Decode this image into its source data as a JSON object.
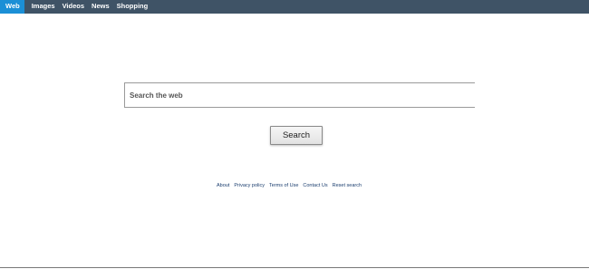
{
  "nav": {
    "items": [
      {
        "label": "Web",
        "active": true
      },
      {
        "label": "Images",
        "active": false
      },
      {
        "label": "Videos",
        "active": false
      },
      {
        "label": "News",
        "active": false
      },
      {
        "label": "Shopping",
        "active": false
      }
    ]
  },
  "search": {
    "placeholder": "Search the web",
    "value": "",
    "button_label": "Search"
  },
  "footer": {
    "links": [
      "About",
      "Privacy policy",
      "Terms of Use",
      "Contact Us",
      "Reset search"
    ]
  },
  "colors": {
    "topbar": "#3f5366",
    "active_tab": "#1b8fd6",
    "footer_link": "#1a3d6e"
  }
}
